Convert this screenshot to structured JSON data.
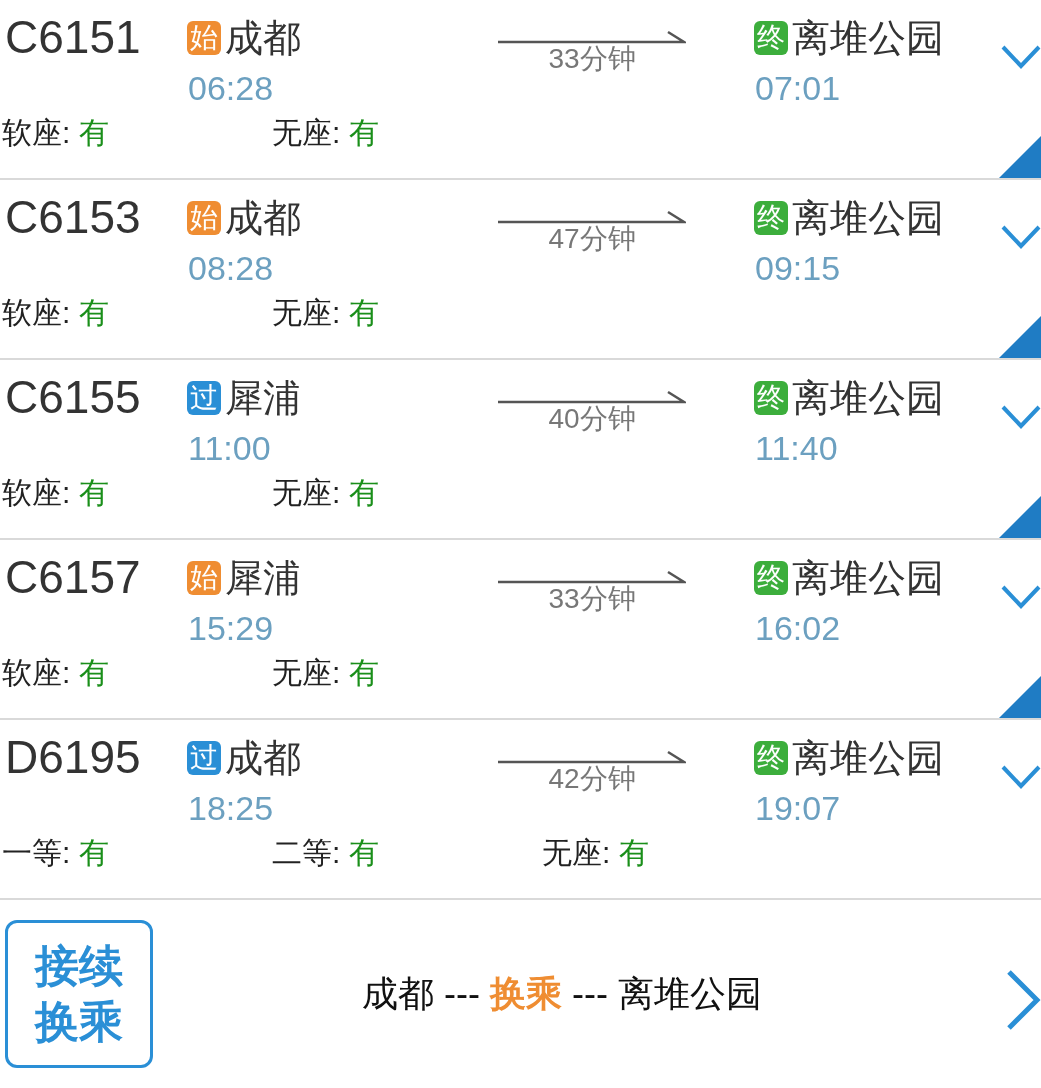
{
  "trains": [
    {
      "number": "C6151",
      "from": {
        "badge": "始",
        "kind": "start",
        "station": "成都",
        "time": "06:28"
      },
      "duration": "33分钟",
      "to": {
        "badge": "终",
        "kind": "end",
        "station": "离堆公园",
        "time": "07:01"
      },
      "seats": [
        {
          "label": "软座:",
          "value": "有"
        },
        {
          "label": "无座:",
          "value": "有"
        }
      ],
      "corner_tag": true
    },
    {
      "number": "C6153",
      "from": {
        "badge": "始",
        "kind": "start",
        "station": "成都",
        "time": "08:28"
      },
      "duration": "47分钟",
      "to": {
        "badge": "终",
        "kind": "end",
        "station": "离堆公园",
        "time": "09:15"
      },
      "seats": [
        {
          "label": "软座:",
          "value": "有"
        },
        {
          "label": "无座:",
          "value": "有"
        }
      ],
      "corner_tag": true
    },
    {
      "number": "C6155",
      "from": {
        "badge": "过",
        "kind": "pass",
        "station": "犀浦",
        "time": "11:00"
      },
      "duration": "40分钟",
      "to": {
        "badge": "终",
        "kind": "end",
        "station": "离堆公园",
        "time": "11:40"
      },
      "seats": [
        {
          "label": "软座:",
          "value": "有"
        },
        {
          "label": "无座:",
          "value": "有"
        }
      ],
      "corner_tag": true
    },
    {
      "number": "C6157",
      "from": {
        "badge": "始",
        "kind": "start",
        "station": "犀浦",
        "time": "15:29"
      },
      "duration": "33分钟",
      "to": {
        "badge": "终",
        "kind": "end",
        "station": "离堆公园",
        "time": "16:02"
      },
      "seats": [
        {
          "label": "软座:",
          "value": "有"
        },
        {
          "label": "无座:",
          "value": "有"
        }
      ],
      "corner_tag": true
    },
    {
      "number": "D6195",
      "from": {
        "badge": "过",
        "kind": "pass",
        "station": "成都",
        "time": "18:25"
      },
      "duration": "42分钟",
      "to": {
        "badge": "终",
        "kind": "end",
        "station": "离堆公园",
        "time": "19:07"
      },
      "seats": [
        {
          "label": "一等:",
          "value": "有"
        },
        {
          "label": "二等:",
          "value": "有"
        },
        {
          "label": "无座:",
          "value": "有"
        }
      ],
      "corner_tag": false
    }
  ],
  "transfer": {
    "button": "接续换乘",
    "route": "成都 --- **换乘** --- 离堆公园"
  }
}
